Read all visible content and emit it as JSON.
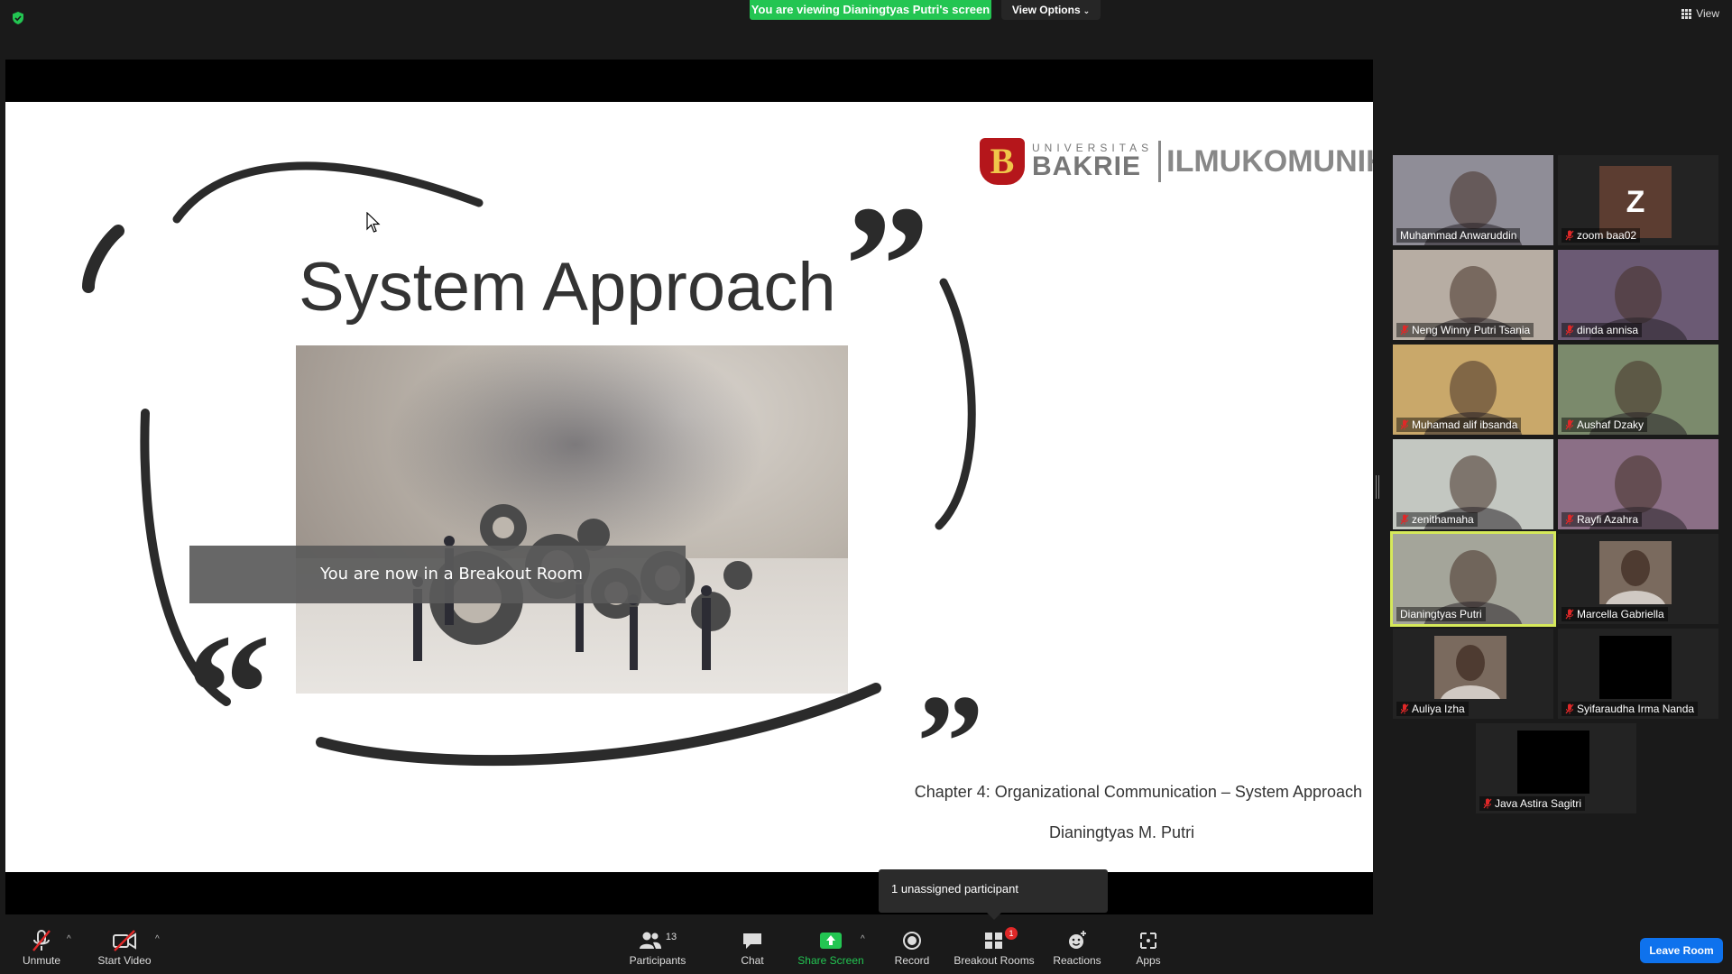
{
  "top": {
    "viewing_banner": "You are viewing Dianingtyas Putri's screen",
    "view_options": "View Options",
    "view_label": "View"
  },
  "slide": {
    "title": "System Approach",
    "logo_universitas": "UNIVERSITAS",
    "logo_bakrie": "BAKRIE",
    "logo_ilkom": "ILMUKOMUNIKASI",
    "logo_mark": "B",
    "caption": "Chapter 4: Organizational Communication – System Approach",
    "author": "Dianingtyas M. Putri"
  },
  "notice": {
    "breakout": "You are now in a Breakout Room",
    "unassigned": "1 unassigned participant"
  },
  "gallery": [
    {
      "name": "Muhammad Anwaruddin",
      "muted": false,
      "bg": "#8f8d97"
    },
    {
      "name": "zoom baa02",
      "muted": true,
      "avatar": "Z",
      "bg": "#232323"
    },
    {
      "name": "Neng Winny Putri Tsania",
      "muted": true,
      "bg": "#b7ada3"
    },
    {
      "name": "dinda annisa",
      "muted": true,
      "bg": "#6b5a74"
    },
    {
      "name": "Muhamad alif ibsanda",
      "muted": true,
      "bg": "#c9a86a"
    },
    {
      "name": "Aushaf Dzaky",
      "muted": true,
      "bg": "#7b8a6c"
    },
    {
      "name": "zenithamaha",
      "muted": true,
      "bg": "#c3c7c1"
    },
    {
      "name": "Rayfi Azahra",
      "muted": true,
      "bg": "#8b6f86"
    },
    {
      "name": "Dianingtyas Putri",
      "muted": false,
      "active": true,
      "bg": "#a4a59a"
    },
    {
      "name": "Marcella Gabriella",
      "muted": true,
      "bg": "#232323"
    },
    {
      "name": "Auliya Izha",
      "muted": true,
      "bg": "#232323"
    },
    {
      "name": "Syifaraudha Irma Nanda",
      "muted": true,
      "bg": "#232323"
    },
    {
      "name": "Java Astira Sagitri",
      "muted": true,
      "bg": "#232323"
    }
  ],
  "toolbar": {
    "unmute": "Unmute",
    "start_video": "Start Video",
    "participants": "Participants",
    "participants_count": "13",
    "chat": "Chat",
    "share_screen": "Share Screen",
    "record": "Record",
    "breakout_rooms": "Breakout Rooms",
    "breakout_badge": "1",
    "reactions": "Reactions",
    "apps": "Apps",
    "leave_room": "Leave Room"
  },
  "colors": {
    "accent_green": "#23c552",
    "leave_blue": "#0e72ed",
    "active_outline": "#d6e95a",
    "logo_red": "#b5161b"
  }
}
